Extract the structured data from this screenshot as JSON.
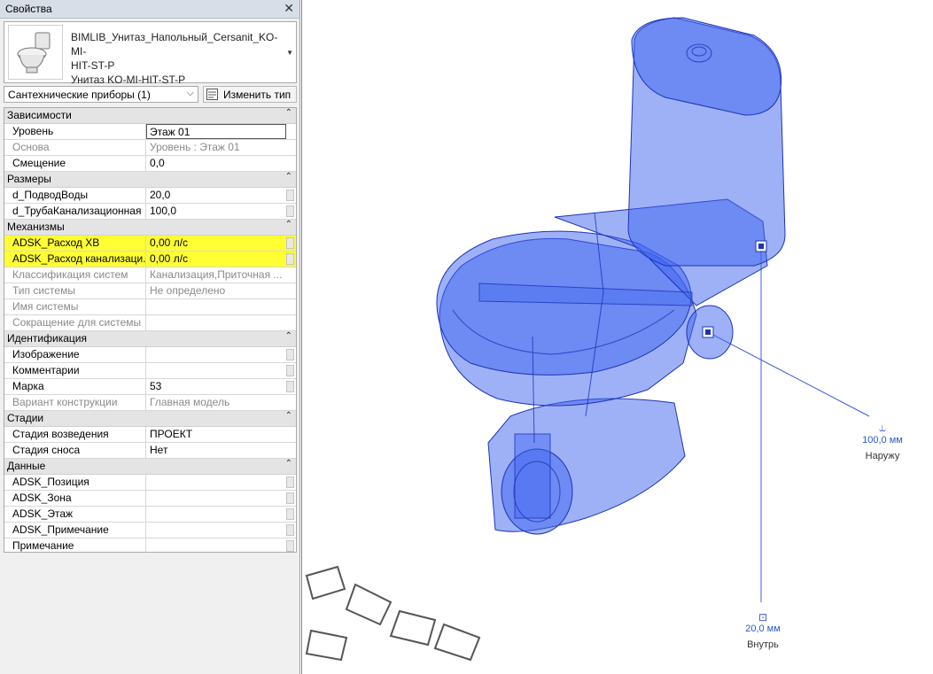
{
  "panel": {
    "title": "Свойства",
    "close_icon": "close-icon",
    "type_selector": {
      "family_line1": "BIMLIB_Унитаз_Напольный_Cersanit_KO-MI-",
      "family_line2": "HIT-ST-P",
      "type_name": "Унитаз KO-MI-HIT-ST-P"
    },
    "category_filter": "Сантехнические приборы (1)",
    "edit_type_label": "Изменить тип"
  },
  "groups": [
    {
      "name": "Зависимости",
      "rows": [
        {
          "key": "Уровень",
          "value": "Этаж 01",
          "state": "edit"
        },
        {
          "key": "Основа",
          "value": "Уровень : Этаж 01",
          "state": "dim"
        },
        {
          "key": "Смещение",
          "value": "0,0",
          "state": "normal"
        }
      ]
    },
    {
      "name": "Размеры",
      "rows": [
        {
          "key": "d_ПодводВоды",
          "value": "20,0",
          "state": "normal"
        },
        {
          "key": "d_ТрубаКанализационная",
          "value": "100,0",
          "state": "normal"
        }
      ]
    },
    {
      "name": "Механизмы",
      "rows": [
        {
          "key": "ADSK_Расход ХВ",
          "value": "0,00 л/с",
          "state": "highlight"
        },
        {
          "key": "ADSK_Расход канализаци...",
          "value": "0,00 л/с",
          "state": "highlight"
        },
        {
          "key": "Классификация систем",
          "value": "Канализация,Приточная ...",
          "state": "dim"
        },
        {
          "key": "Тип системы",
          "value": "Не определено",
          "state": "dim"
        },
        {
          "key": "Имя системы",
          "value": "",
          "state": "dim"
        },
        {
          "key": "Сокращение для системы",
          "value": "",
          "state": "dim"
        }
      ]
    },
    {
      "name": "Идентификация",
      "rows": [
        {
          "key": "Изображение",
          "value": "",
          "state": "normal"
        },
        {
          "key": "Комментарии",
          "value": "",
          "state": "normal"
        },
        {
          "key": "Марка",
          "value": "53",
          "state": "normal"
        },
        {
          "key": "Вариант конструкции",
          "value": "Главная модель",
          "state": "dim"
        }
      ]
    },
    {
      "name": "Стадии",
      "rows": [
        {
          "key": "Стадия возведения",
          "value": "ПРОЕКТ",
          "state": "normal"
        },
        {
          "key": "Стадия сноса",
          "value": "Нет",
          "state": "normal"
        }
      ]
    },
    {
      "name": "Данные",
      "rows": [
        {
          "key": "ADSK_Позиция",
          "value": "",
          "state": "normal"
        },
        {
          "key": "ADSK_Зона",
          "value": "",
          "state": "normal"
        },
        {
          "key": "ADSK_Этаж",
          "value": "",
          "state": "normal"
        },
        {
          "key": "ADSK_Примечание",
          "value": "",
          "state": "normal"
        },
        {
          "key": "Примечание",
          "value": "",
          "state": "normal"
        }
      ]
    }
  ],
  "viewport": {
    "connector_sewer": {
      "size": "100,0 мм",
      "direction": "Наружу",
      "icon": "pipe-connector-icon"
    },
    "connector_water": {
      "size": "20,0 мм",
      "direction": "Внутрь",
      "icon": "water-connector-icon"
    }
  },
  "colors": {
    "accent": "#2a59c8",
    "highlight": "#ffff33",
    "model_fill": "#3d63f0"
  }
}
